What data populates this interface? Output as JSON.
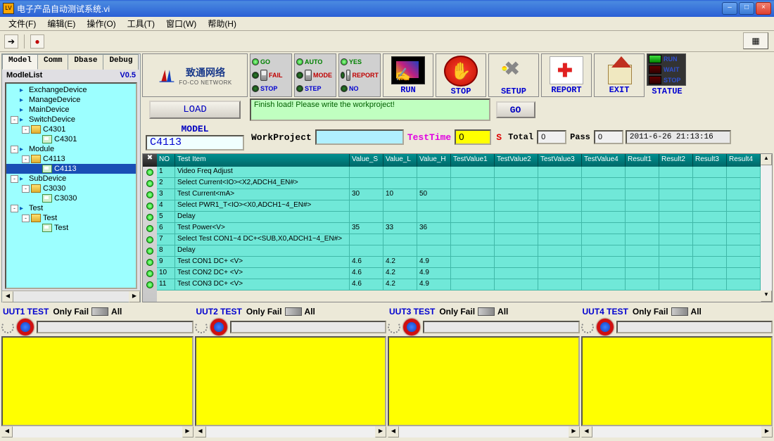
{
  "window": {
    "title": "电子产品自动测试系统.vi",
    "minimize": "–",
    "maximize": "□",
    "close": "×"
  },
  "menu": [
    "文件(F)",
    "编辑(E)",
    "操作(O)",
    "工具(T)",
    "窗口(W)",
    "帮助(H)"
  ],
  "toolbar": {
    "run": "➔",
    "stop": "●"
  },
  "left": {
    "tabs": [
      "Model",
      "Comm",
      "Dbase",
      "Debug"
    ],
    "header": "ModleList",
    "version": "V0.5",
    "tree": [
      {
        "depth": 0,
        "exp": "",
        "icon": "bolt",
        "label": "ExchangeDevice"
      },
      {
        "depth": 0,
        "exp": "",
        "icon": "bolt",
        "label": "ManageDevice"
      },
      {
        "depth": 0,
        "exp": "",
        "icon": "bolt",
        "label": "MainDevice"
      },
      {
        "depth": 0,
        "exp": "-",
        "icon": "bolt",
        "label": "SwitchDevice"
      },
      {
        "depth": 1,
        "exp": "-",
        "icon": "folder",
        "label": "C4301"
      },
      {
        "depth": 2,
        "exp": "",
        "icon": "card",
        "label": "C4301"
      },
      {
        "depth": 0,
        "exp": "-",
        "icon": "bolt",
        "label": "Module"
      },
      {
        "depth": 1,
        "exp": "-",
        "icon": "folder",
        "label": "C4113"
      },
      {
        "depth": 2,
        "exp": "",
        "icon": "card",
        "label": "C4113",
        "sel": true
      },
      {
        "depth": 0,
        "exp": "-",
        "icon": "bolt",
        "label": "SubDevice"
      },
      {
        "depth": 1,
        "exp": "-",
        "icon": "folder",
        "label": "C3030"
      },
      {
        "depth": 2,
        "exp": "",
        "icon": "card",
        "label": "C3030"
      },
      {
        "depth": 0,
        "exp": "-",
        "icon": "bolt",
        "label": "Test"
      },
      {
        "depth": 1,
        "exp": "-",
        "icon": "folder",
        "label": "Test"
      },
      {
        "depth": 2,
        "exp": "",
        "icon": "card",
        "label": "Test"
      }
    ]
  },
  "logo": {
    "cn": "致通网络",
    "en": "FO-CO NETWORK"
  },
  "lights1": [
    {
      "label": "GO",
      "cls": "green",
      "on": true
    },
    {
      "label": "FAIL",
      "cls": "red",
      "on": false,
      "sw": true
    },
    {
      "label": "STOP",
      "cls": "blue",
      "on": false
    }
  ],
  "lights2": [
    {
      "label": "AUTO",
      "cls": "green",
      "on": true
    },
    {
      "label": "MODE",
      "cls": "red",
      "on": false,
      "sw": true
    },
    {
      "label": "STEP",
      "cls": "blue",
      "on": false
    }
  ],
  "lights3": [
    {
      "label": "YES",
      "cls": "green",
      "on": true
    },
    {
      "label": "REPORT",
      "cls": "red",
      "on": false,
      "sw": true
    },
    {
      "label": "NO",
      "cls": "blue",
      "on": false
    }
  ],
  "bigButtons": {
    "run": "RUN",
    "stop": "STOP",
    "setup": "SETUP",
    "report": "REPORT",
    "exit": "EXIT",
    "statue": "STATUE"
  },
  "statue": [
    {
      "label": "RUN",
      "on": true
    },
    {
      "label": "WAIT",
      "on": false
    },
    {
      "label": "STOP",
      "on": false
    }
  ],
  "load": "LOAD",
  "message": "Finish load! Please write the workproject!",
  "go": "GO",
  "modelLabel": "MODEL",
  "modelValue": "C4113",
  "workProjectLabel": "WorkProject",
  "workProjectValue": "",
  "testTimeLabel": "TestTime",
  "testTimeValue": "0",
  "testTimeUnit": "S",
  "totalLabel": "Total",
  "totalValue": "0",
  "passLabel": "Pass",
  "passValue": "0",
  "datetime": "2011-6-26 21:13:16",
  "tableHeaders": [
    "NO",
    "Test Item",
    "Value_S",
    "Value_L",
    "Value_H",
    "TestValue1",
    "TestValue2",
    "TestValue3",
    "TestValue4",
    "Result1",
    "Result2",
    "Result3",
    "Result4"
  ],
  "tableRows": [
    {
      "no": "1",
      "item": "Video Freq Adjust",
      "vs": "",
      "vl": "",
      "vh": ""
    },
    {
      "no": "2",
      "item": "Select Current<IO><X2,ADCH4_EN#>",
      "vs": "",
      "vl": "",
      "vh": ""
    },
    {
      "no": "3",
      "item": "Test Current<mA>",
      "vs": "30",
      "vl": "10",
      "vh": "50"
    },
    {
      "no": "4",
      "item": "Select PWR1_T<IO><X0,ADCH1~4_EN#>",
      "vs": "",
      "vl": "",
      "vh": ""
    },
    {
      "no": "5",
      "item": "Delay",
      "vs": "",
      "vl": "",
      "vh": ""
    },
    {
      "no": "6",
      "item": "Test Power<V>",
      "vs": "35",
      "vl": "33",
      "vh": "36"
    },
    {
      "no": "7",
      "item": "Select Test CON1~4 DC+<SUB,X0,ADCH1~4_EN#>",
      "vs": "",
      "vl": "",
      "vh": ""
    },
    {
      "no": "8",
      "item": "Delay",
      "vs": "",
      "vl": "",
      "vh": ""
    },
    {
      "no": "9",
      "item": "Test CON1 DC+ <V>",
      "vs": "4.6",
      "vl": "4.2",
      "vh": "4.9"
    },
    {
      "no": "10",
      "item": "Test CON2 DC+ <V>",
      "vs": "4.6",
      "vl": "4.2",
      "vh": "4.9"
    },
    {
      "no": "11",
      "item": "Test CON3 DC+ <V>",
      "vs": "4.6",
      "vl": "4.2",
      "vh": "4.9"
    }
  ],
  "uut": {
    "titles": [
      "UUT1 TEST",
      "UUT2 TEST",
      "UUT3 TEST",
      "UUT4 TEST"
    ],
    "onlyFail": "Only Fail",
    "all": "All"
  }
}
